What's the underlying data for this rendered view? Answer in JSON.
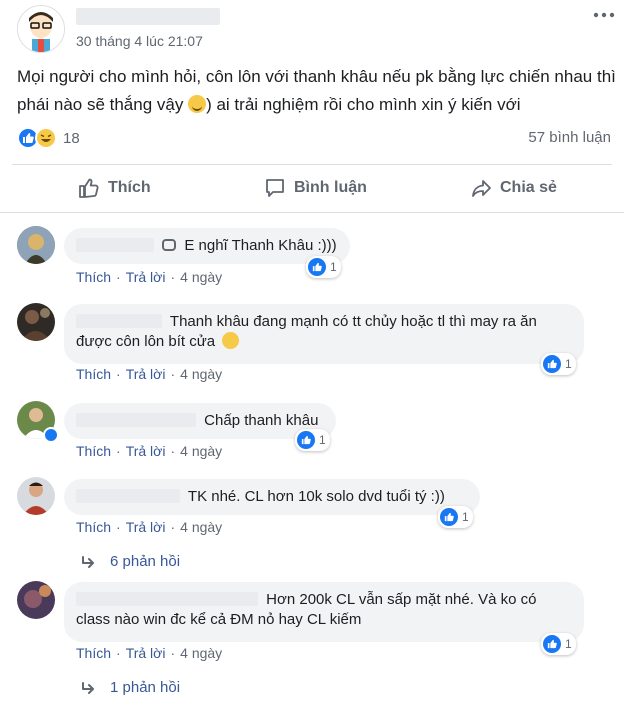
{
  "post": {
    "timestamp": "30 tháng 4 lúc 21:07",
    "text_before": "Mọi người cho mình hỏi, côn lôn với thanh khâu nếu pk bằng lực chiến nhau thì phái nào sẽ thắng vậy",
    "text_after": ") ai trải nghiệm rồi cho mình xin ý kiến với",
    "reaction_count": "18",
    "comment_count": "57 bình luận"
  },
  "actions": {
    "like": "Thích",
    "comment": "Bình luận",
    "share": "Chia sẻ"
  },
  "comments": [
    {
      "text": "E nghĩ Thanh Khâu :)))",
      "like": "Thích",
      "reply": "Trả lời",
      "time": "4 ngày",
      "reactions": "1"
    },
    {
      "text_line1": "Thanh khâu đang mạnh có tt chủy hoặc tl thì may ra ăn",
      "text_line2": "được côn lôn bít cửa",
      "like": "Thích",
      "reply": "Trả lời",
      "time": "4 ngày",
      "reactions": "1"
    },
    {
      "text": "Chấp thanh khâu",
      "like": "Thích",
      "reply": "Trả lời",
      "time": "4 ngày",
      "reactions": "1"
    },
    {
      "text": "TK nhé. CL hơn 10k solo dvd tuổi tý :))",
      "like": "Thích",
      "reply": "Trả lời",
      "time": "4 ngày",
      "reactions": "1",
      "replies": "6 phản hồi"
    },
    {
      "text_line1": "Hơn 200k CL vẫn sấp mặt nhé. Và ko có",
      "text_line2": "class nào win đc kể cả ĐM nỏ hay CL kiếm",
      "like": "Thích",
      "reply": "Trả lời",
      "time": "4 ngày",
      "reactions": "1",
      "replies": "1 phản hồi"
    }
  ],
  "colors": {
    "like_blue": "#1877f2",
    "link_blue": "#385898",
    "bubble_bg": "#f2f3f5",
    "muted_text": "#606770"
  },
  "icons": [
    "more-options-icon",
    "like-reaction-icon",
    "haha-reaction-icon",
    "thumbs-up-icon",
    "comment-icon",
    "share-icon",
    "reply-arrow-icon"
  ]
}
